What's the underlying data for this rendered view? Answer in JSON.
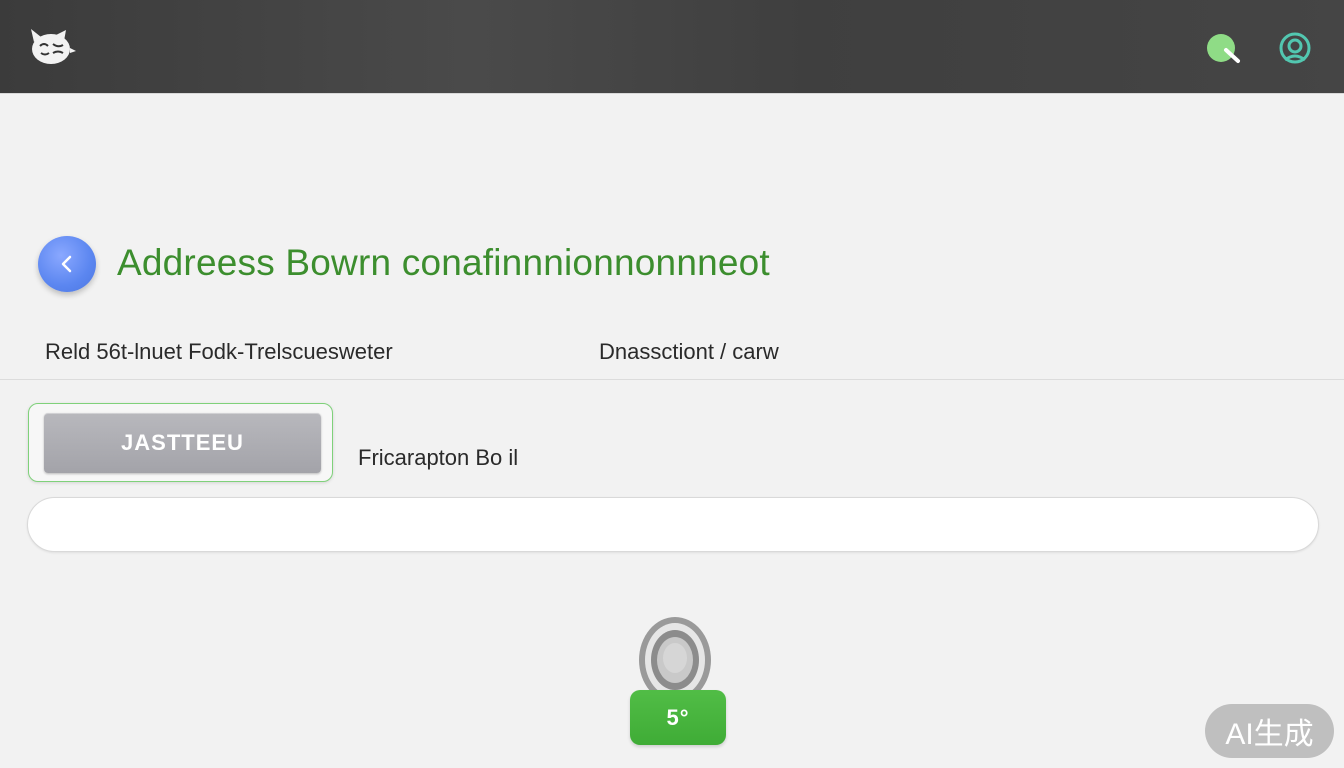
{
  "header": {
    "logo_icon": "cat-logo-icon",
    "status_icon": "status-search-icon",
    "profile_icon": "profile-icon",
    "status_color": "#8fdc86",
    "accent_color": "#52c7b0"
  },
  "main": {
    "back_icon": "chevron-left-icon",
    "title": "Addreess Bowrn conafinnnionnonnneot",
    "title_color": "#3c8e2e",
    "meta_left": "Reld 56t-lnuet Fodk-Trelscuesweter",
    "meta_right": "Dnassctiont / carw",
    "action_button_label": "JASTTEEU",
    "action_label": "Fricarapton Bo il",
    "input_value": "",
    "input_placeholder": "",
    "knob_icon": "dial-knob-icon",
    "submit_label": "5°",
    "submit_color": "#47b53d"
  },
  "watermark": "AI生成"
}
